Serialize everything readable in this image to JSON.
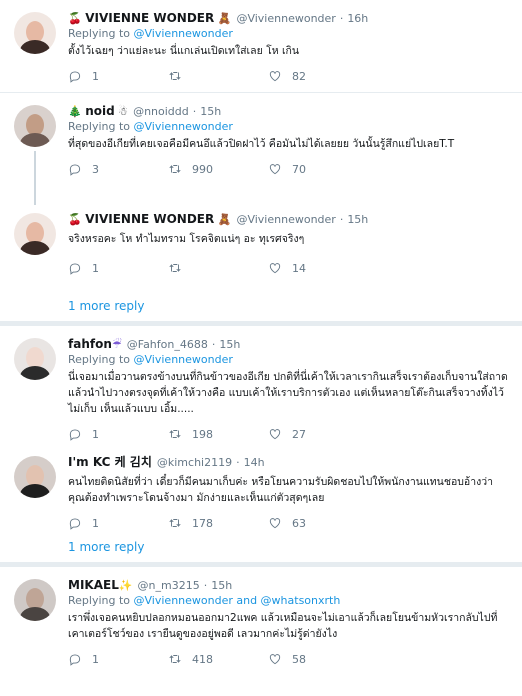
{
  "tweets": [
    {
      "name": "VIVIENNE WONDER",
      "emoji_before": "🍒",
      "emoji_after": "🧸",
      "handle": "@Viviennewonder",
      "time": "16h",
      "replying_prefix": "Replying to",
      "replying_to": "@Viviennewonder",
      "text": "ตั้งไว้เฉยๆ ว่าแย่ละนะ นี่แกเล่นเปิดเทใส่เลย โห เกิน",
      "replies": "1",
      "retweets": "",
      "likes": "82"
    },
    {
      "name": "noid",
      "emoji_before": "🎄",
      "emoji_after": "☃",
      "handle": "@nnoiddd",
      "time": "15h",
      "replying_prefix": "Replying to",
      "replying_to": "@Viviennewonder",
      "text": "ที่สุดของอีเกียที่เคยเจอคือมีคนอึแล้วปิดฝาไว้ คือมันไม่ได้เลยยย วันนั้นรู้สึกแย่ไปเลยT.T",
      "replies": "3",
      "retweets": "990",
      "likes": "70"
    },
    {
      "name": "VIVIENNE WONDER",
      "emoji_before": "🍒",
      "emoji_after": "🧸",
      "handle": "@Viviennewonder",
      "time": "15h",
      "replying_prefix": "",
      "replying_to": "",
      "text": "จริงหรอคะ โห ทำไมทราม โรคจิตแน่ๆ อะ ทุเรศจริงๆ",
      "replies": "1",
      "retweets": "",
      "likes": "14"
    },
    {
      "name": "fahfon",
      "emoji_before": "",
      "emoji_after": "☔",
      "handle": "@Fahfon_4688",
      "time": "15h",
      "replying_prefix": "Replying to",
      "replying_to": "@Viviennewonder",
      "text": "นี่เจอมาเมื่อวานตรงข้างบนที่กินข้าวของอีเกีย ปกติที่นี่เค้าให้เวลาเรากินเสร็จเราต้องเก็บจานใส่ถาดแล้วนำไปวางตรงจุดที่เค้าให้วางคือ แบบเค้าให้เราบริการตัวเอง แต่เห็นหลายโต๊ะกินเสร็จวางทิ้งไว้ไม่เก็บ เห็นแล้วแบบ เอิ้ม.....",
      "replies": "1",
      "retweets": "198",
      "likes": "27"
    },
    {
      "name": "I'm KC 케 김치",
      "emoji_before": "",
      "emoji_after": "",
      "handle": "@kimchi2119",
      "time": "14h",
      "replying_prefix": "",
      "replying_to": "",
      "text": "คนไทยติดนิสัยที่ว่า เดี๋ยวก็มีคนมาเก็บค่ะ หรือโยนความรับผิดชอบไปให้พนักงานแทนชอบอ้างว่าคุณต้องทำเพราะโดนจ้างมา มักง่ายและเห็นแก่ตัวสุดๆเลย",
      "replies": "1",
      "retweets": "178",
      "likes": "63"
    },
    {
      "name": "MIKAEL",
      "emoji_before": "",
      "emoji_after": "✨",
      "handle": "@n_m3215",
      "time": "15h",
      "replying_prefix": "Replying to",
      "replying_to": "@Viviennewonder and @whatsonxrth",
      "text": "เราพึ่งเจอคนหยิบปลอกหมอนออกมา2แพค แล้วเหมือนจะไม่เอาแล้วก็เลยโยนข้ามหัวเรากลับไปที่เคาเตอร์โชว์ของ เรายืนดูของอยู่พอดี เลวมากค่ะไม่รู้ด่ายังไง",
      "replies": "1",
      "retweets": "418",
      "likes": "58"
    }
  ],
  "more_replies": [
    "1 more reply",
    "1 more reply"
  ],
  "icons": {
    "reply": "reply-icon",
    "retweet": "retweet-icon",
    "like": "heart-icon"
  }
}
